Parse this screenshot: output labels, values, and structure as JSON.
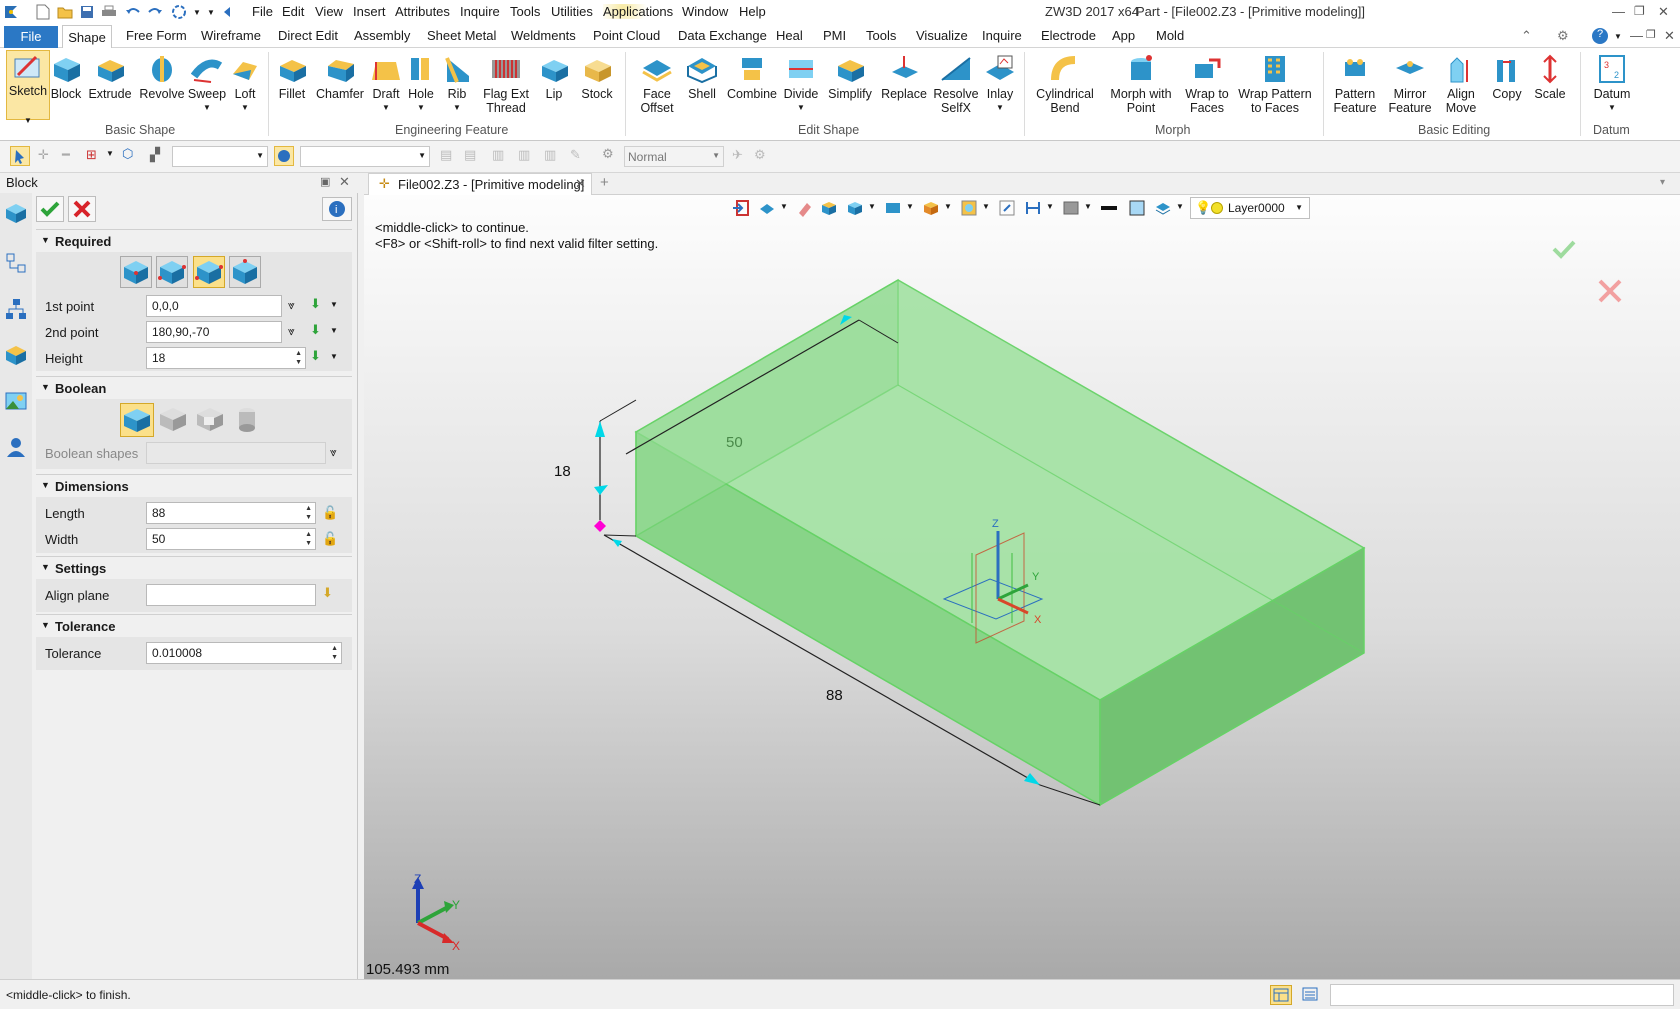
{
  "titlebar": {
    "menus": [
      "File",
      "Edit",
      "View",
      "Insert",
      "Attributes",
      "Inquire",
      "Tools",
      "Utilities",
      "Applications",
      "Window",
      "Help"
    ],
    "app_title": "ZW3D 2017  x64",
    "doc_title": "Part - [File002.Z3 - [Primitive modeling]]"
  },
  "ribbon_tabs": [
    "File",
    "Shape",
    "Free Form",
    "Wireframe",
    "Direct Edit",
    "Assembly",
    "Sheet Metal",
    "Weldments",
    "Point Cloud",
    "Data Exchange",
    "Heal",
    "PMI",
    "Tools",
    "Visualize",
    "Inquire",
    "Electrode",
    "App",
    "Mold"
  ],
  "ribbon_active_tab": "Shape",
  "ribbon": {
    "groups": [
      "Basic Shape",
      "Engineering Feature",
      "Edit Shape",
      "Morph",
      "Basic Editing",
      "Datum"
    ],
    "buttons": {
      "sketch": "Sketch",
      "block": "Block",
      "extrude": "Extrude",
      "revolve": "Revolve",
      "sweep": "Sweep",
      "loft": "Loft",
      "fillet": "Fillet",
      "chamfer": "Chamfer",
      "draft": "Draft",
      "hole": "Hole",
      "rib": "Rib",
      "flag_ext_thread": "Flag Ext\nThread",
      "lip": "Lip",
      "stock": "Stock",
      "face_offset": "Face\nOffset",
      "shell": "Shell",
      "combine": "Combine",
      "divide": "Divide",
      "simplify": "Simplify",
      "replace": "Replace",
      "resolve_selfx": "Resolve\nSelfX",
      "inlay": "Inlay",
      "cylindrical_bend": "Cylindrical\nBend",
      "morph_with_point": "Morph with\nPoint",
      "wrap_to_faces": "Wrap to\nFaces",
      "wrap_pattern": "Wrap Pattern\nto Faces",
      "pattern_feature": "Pattern\nFeature",
      "mirror_feature": "Mirror\nFeature",
      "align_move": "Align\nMove",
      "copy": "Copy",
      "scale": "Scale",
      "datum": "Datum"
    }
  },
  "toolbar2": {
    "filter_value": "Normal"
  },
  "panel": {
    "title": "Block",
    "required": {
      "header": "Required",
      "first_point_label": "1st point",
      "first_point_value": "0,0,0",
      "second_point_label": "2nd point",
      "second_point_value": "180,90,-70",
      "height_label": "Height",
      "height_value": "18"
    },
    "boolean": {
      "header": "Boolean",
      "shapes_label": "Boolean shapes",
      "shapes_value": ""
    },
    "dimensions": {
      "header": "Dimensions",
      "length_label": "Length",
      "length_value": "88",
      "width_label": "Width",
      "width_value": "50"
    },
    "settings": {
      "header": "Settings",
      "align_plane_label": "Align plane",
      "align_plane_value": ""
    },
    "tolerance": {
      "header": "Tolerance",
      "tolerance_label": "Tolerance",
      "tolerance_value": "0.010008"
    }
  },
  "doc_tab": {
    "label": "File002.Z3 - [Primitive modeling]"
  },
  "viewport": {
    "hint_line1": "<middle-click> to continue.",
    "hint_line2": "<F8> or <Shift-roll> to find next valid filter setting.",
    "layer": "Layer0000",
    "dim_width": "50",
    "dim_height": "18",
    "dim_length": "88",
    "distance_readout": "105.493 mm",
    "axis_x": "X",
    "axis_y": "Y",
    "axis_z": "Z"
  },
  "status": {
    "message": "<middle-click> to finish."
  },
  "colors": {
    "accent": "#2b78c5",
    "solid_fill": "#8fd98f",
    "solid_edge": "#66d266",
    "active_tab": "#3c8ed8"
  }
}
